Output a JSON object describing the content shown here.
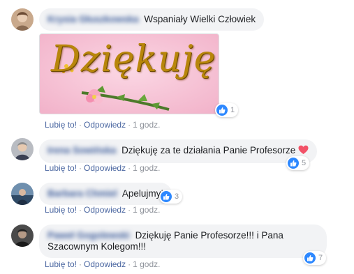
{
  "comments": [
    {
      "author": "Krysia Głuszkowska",
      "text": "Wspaniały Wielki Człowiek",
      "sticker_text": "Dziękuję",
      "like_label": "Lubię to!",
      "reply_label": "Odpowiedz",
      "time": "1 godz.",
      "reactions": "1"
    },
    {
      "author": "Irena Sowińska",
      "text": "Dziękuję za te działania Panie Profesorze",
      "like_label": "Lubię to!",
      "reply_label": "Odpowiedz",
      "time": "1 godz.",
      "reactions": "5"
    },
    {
      "author": "Barbara Chmiel",
      "text": "Apelujmy!",
      "like_label": "Lubię to!",
      "reply_label": "Odpowiedz",
      "time": "1 godz.",
      "reactions": "3"
    },
    {
      "author": "Paweł Gogolewski",
      "text_line1": "Dziękuję Panie Profesorze!!! i Pana",
      "text_line2": "Szacownym Kolegom!!!",
      "like_label": "Lubię to!",
      "reply_label": "Odpowiedz",
      "time": "1 godz.",
      "reactions": "7"
    }
  ],
  "colors": {
    "link": "#4b67a1",
    "bubble": "#f2f3f5",
    "like": "#2d88ff",
    "heart": "#f25268"
  }
}
